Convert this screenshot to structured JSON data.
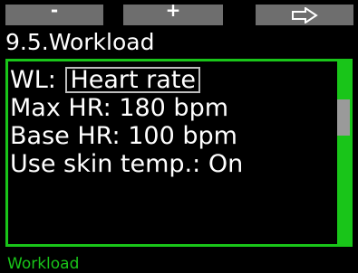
{
  "softkeys": {
    "minus_label": "-",
    "plus_label": "+",
    "next_icon": "right-arrow-icon"
  },
  "screen": {
    "title": "9.5.Workload"
  },
  "settings": {
    "wl_label": "WL:",
    "wl_value": "Heart rate",
    "max_hr": "Max HR: 180 bpm",
    "base_hr": "Base HR: 100 bpm",
    "skin_temp": "Use skin temp.: On"
  },
  "footer": {
    "label": "Workload"
  },
  "colors": {
    "accent": "#19c519",
    "softkey_bg": "#6e6e6e",
    "selection_border": "#bdbdbd",
    "scroll_thumb": "#9a9a9a"
  }
}
